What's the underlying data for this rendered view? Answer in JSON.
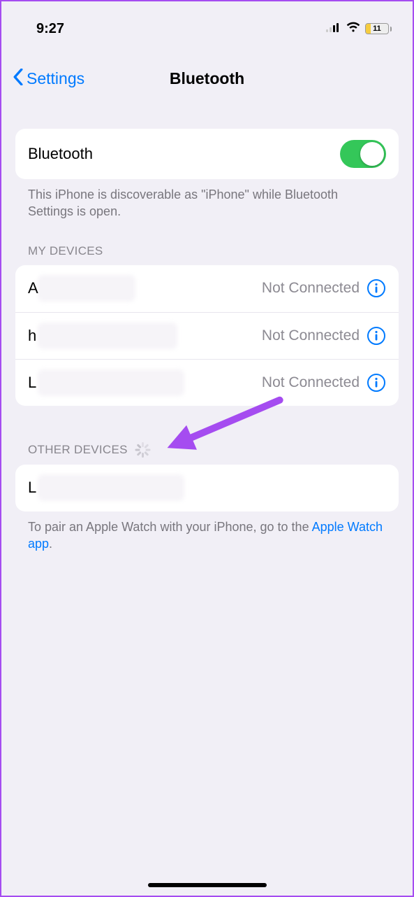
{
  "statusbar": {
    "time": "9:27",
    "battery_pct": "11"
  },
  "nav": {
    "back_label": "Settings",
    "title": "Bluetooth"
  },
  "main_toggle": {
    "label": "Bluetooth",
    "footer": "This iPhone is discoverable as \"iPhone\" while Bluetooth Settings is open."
  },
  "my_devices": {
    "header": "MY DEVICES",
    "items": [
      {
        "initial": "A",
        "status": "Not Connected"
      },
      {
        "initial": "h",
        "status": "Not Connected"
      },
      {
        "initial": "L",
        "status": "Not Connected"
      }
    ]
  },
  "other_devices": {
    "header": "OTHER DEVICES",
    "items": [
      {
        "initial": "L"
      }
    ]
  },
  "pair_footer": {
    "prefix": "To pair an Apple Watch with your iPhone, go to the ",
    "link": "Apple Watch app",
    "suffix": "."
  }
}
